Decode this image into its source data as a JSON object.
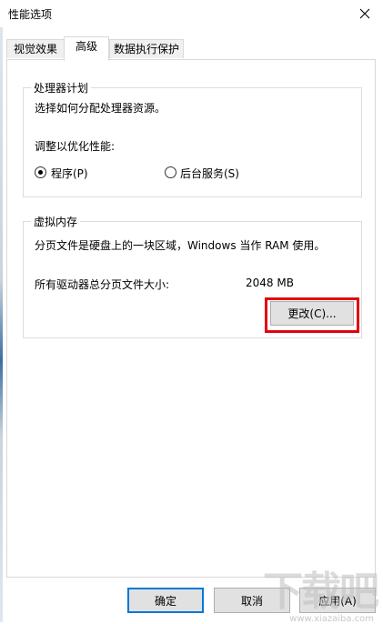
{
  "window": {
    "title": "性能选项",
    "close_icon": "close-icon"
  },
  "tabs": [
    {
      "label": "视觉效果"
    },
    {
      "label": "高级",
      "active": true
    },
    {
      "label": "数据执行保护"
    }
  ],
  "processor": {
    "group_title": "处理器计划",
    "description": "选择如何分配处理器资源。",
    "optimize_label": "调整以优化性能:",
    "option_programs": "程序(P)",
    "option_background": "后台服务(S)",
    "selected": "程序(P)"
  },
  "virtual_memory": {
    "group_title": "虚拟内存",
    "description": "分页文件是硬盘上的一块区域，Windows 当作 RAM 使用。",
    "total_label": "所有驱动器总分页文件大小:",
    "total_value": "2048 MB",
    "change_button": "更改(C)..."
  },
  "footer": {
    "ok_button": "确定",
    "cancel_button": "取消",
    "apply_button": "应用(A)"
  },
  "watermark": {
    "text": "下载吧",
    "url": "www.xiazaiba.com"
  },
  "colors": {
    "highlight": "#e3000f",
    "focus": "#0078d7"
  }
}
